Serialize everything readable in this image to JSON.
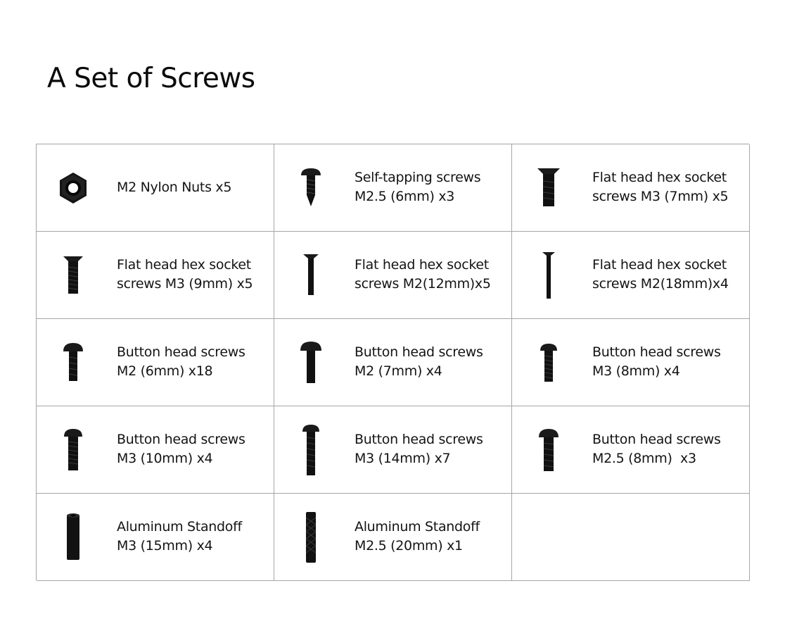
{
  "page": {
    "title": "A Set of Screws"
  },
  "items": [
    {
      "icon": "hex-nut-icon",
      "lines": [
        "M2 Nylon Nuts x5"
      ]
    },
    {
      "icon": "self-tapping-screw-icon",
      "lines": [
        "Self-tapping screws",
        "M2.5 (6mm) x3"
      ]
    },
    {
      "icon": "flat-head-screw-icon",
      "lines": [
        "Flat head hex socket",
        "screws M3 (7mm) x5"
      ]
    },
    {
      "icon": "flat-head-screw-icon",
      "lines": [
        "Flat head hex socket",
        "screws M3 (9mm) x5"
      ]
    },
    {
      "icon": "flat-head-screw-icon",
      "lines": [
        "Flat head hex socket",
        "screws M2(12mm)x5"
      ]
    },
    {
      "icon": "flat-head-screw-icon",
      "lines": [
        "Flat head hex socket",
        "screws M2(18mm)x4"
      ]
    },
    {
      "icon": "button-head-screw-icon",
      "lines": [
        "Button head screws",
        "M2 (6mm) x18"
      ]
    },
    {
      "icon": "button-head-screw-icon",
      "lines": [
        "Button head screws",
        "M2 (7mm) x4"
      ]
    },
    {
      "icon": "button-head-screw-icon",
      "lines": [
        "Button head screws",
        "M3 (8mm) x4"
      ]
    },
    {
      "icon": "button-head-screw-icon",
      "lines": [
        "Button head screws",
        "M3 (10mm) x4"
      ]
    },
    {
      "icon": "button-head-screw-icon",
      "lines": [
        "Button head screws",
        "M3 (14mm) x7"
      ]
    },
    {
      "icon": "button-head-screw-icon",
      "lines": [
        "Button head screws",
        "M2.5 (8mm)  x3"
      ]
    },
    {
      "icon": "standoff-icon",
      "lines": [
        "Aluminum Standoff",
        "M3 (15mm) x4"
      ]
    },
    {
      "icon": "knurled-standoff-icon",
      "lines": [
        "Aluminum Standoff",
        "M2.5 (20mm) x1"
      ]
    }
  ],
  "colors": {
    "border": "#a6a6a6",
    "hardware": "#141414"
  }
}
